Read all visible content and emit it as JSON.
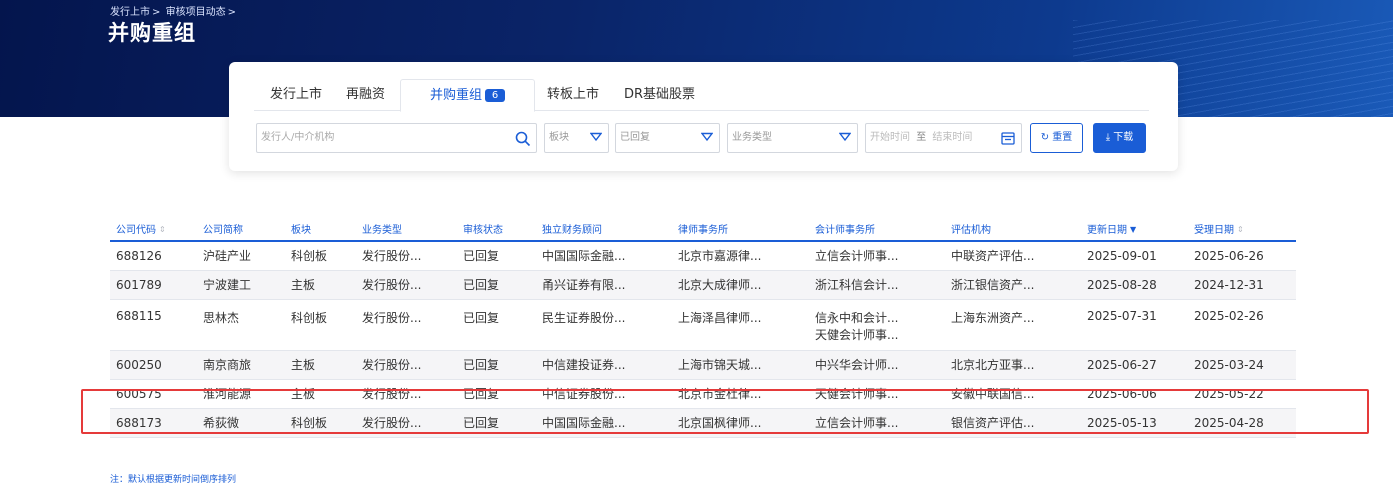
{
  "breadcrumb": {
    "items": [
      "发行上市",
      "审核项目动态"
    ],
    "separator": ">"
  },
  "page_title": "并购重组",
  "tabs": [
    {
      "label": "发行上市"
    },
    {
      "label": "再融资"
    },
    {
      "label": "并购重组",
      "badge": "6",
      "active": true
    },
    {
      "label": "转板上市"
    },
    {
      "label": "DR基础股票"
    }
  ],
  "filters": {
    "search_placeholder": "发行人/中介机构",
    "board": "板块",
    "status": "已回复",
    "business_type": "业务类型",
    "start_placeholder": "开始时间",
    "to": "至",
    "end_placeholder": "结束时间",
    "reset_label": "重置",
    "download_label": "下载"
  },
  "table": {
    "headers": [
      "公司代码",
      "公司简称",
      "板块",
      "业务类型",
      "审核状态",
      "独立财务顾问",
      "律师事务所",
      "会计师事务所",
      "评估机构",
      "更新日期",
      "受理日期"
    ],
    "rows": [
      [
        "688126",
        "沪硅产业",
        "科创板",
        "发行股份...",
        "已回复",
        "中国国际金融...",
        "北京市嘉源律...",
        "立信会计师事...",
        "中联资产评估...",
        "2025-09-01",
        "2025-06-26"
      ],
      [
        "601789",
        "宁波建工",
        "主板",
        "发行股份...",
        "已回复",
        "甬兴证券有限...",
        "北京大成律师...",
        "浙江科信会计...",
        "浙江银信资产...",
        "2025-08-28",
        "2024-12-31"
      ],
      [
        "688115",
        "思林杰",
        "科创板",
        "发行股份...",
        "已回复",
        "民生证券股份...",
        "上海泽昌律师...",
        "信永中和会计...\n天健会计师事...",
        "上海东洲资产...",
        "2025-07-31",
        "2025-02-26"
      ],
      [
        "600250",
        "南京商旅",
        "主板",
        "发行股份...",
        "已回复",
        "中信建投证券...",
        "上海市锦天城...",
        "中兴华会计师...",
        "北京北方亚事...",
        "2025-06-27",
        "2025-03-24"
      ],
      [
        "600575",
        "淮河能源",
        "主板",
        "发行股份...",
        "已回复",
        "中信证券股份...",
        "北京市金杜律...",
        "天健会计师事...",
        "安徽中联国信...",
        "2025-06-06",
        "2025-05-22"
      ],
      [
        "688173",
        "希荻微",
        "科创板",
        "发行股份...",
        "已回复",
        "中国国际金融...",
        "北京国枫律师...",
        "立信会计师事...",
        "银信资产评估...",
        "2025-05-13",
        "2025-04-28"
      ]
    ]
  },
  "note": "注：默认根据更新时间倒序排列",
  "colors": {
    "accent": "#1a5dd6",
    "highlight": "#e53a3a",
    "banner": "#0a2468"
  }
}
